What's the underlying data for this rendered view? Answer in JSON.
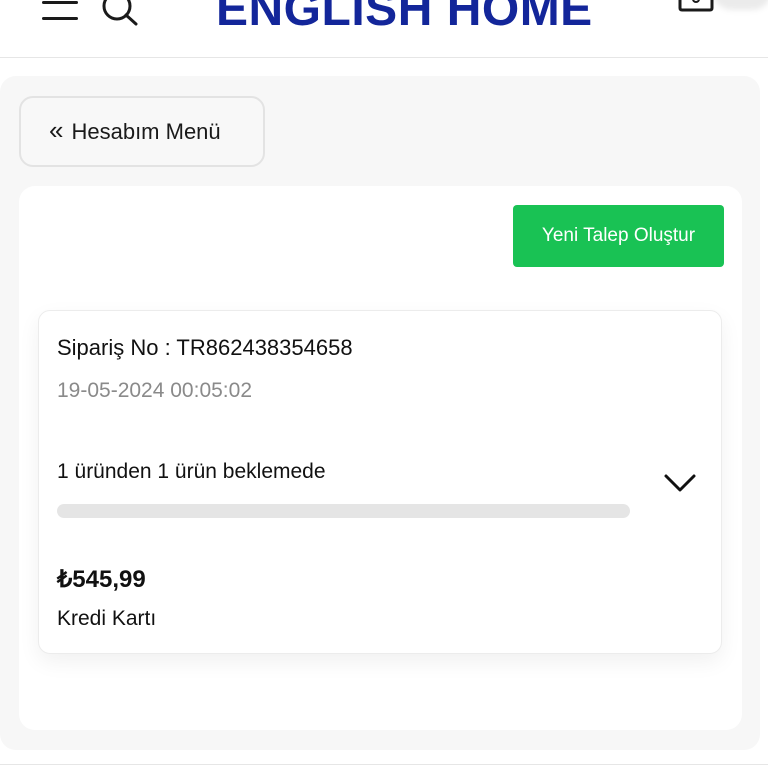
{
  "header": {
    "brand": "ENGLISH HOME",
    "menu_icon": "hamburger-menu-icon",
    "search_icon": "search-icon",
    "cart_icon": "shopping-bag-icon",
    "brand_color": "#13269a"
  },
  "account": {
    "back_icon": "«",
    "back_label": "Hesabım Menü",
    "new_request_label": "Yeni Talep Oluştur",
    "accent_color": "#19c254"
  },
  "order": {
    "number": "Sipariş No : TR862438354658",
    "date": "19-05-2024 00:05:02",
    "status": "1 üründen 1 ürün beklemede",
    "progress": 0,
    "expand_icon": "chevron-down-icon",
    "price": "₺545,99",
    "payment": "Kredi Kartı"
  }
}
